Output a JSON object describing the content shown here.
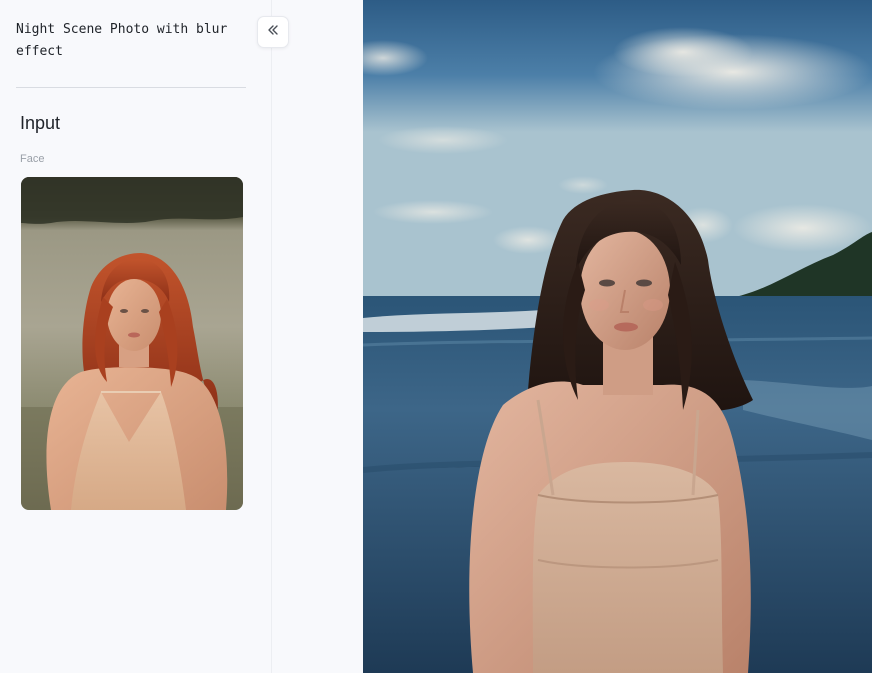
{
  "sidebar": {
    "workflow_title": "Night Scene Photo with blur effect",
    "section_title": "Input",
    "face_label": "Face",
    "face_image_alt": "woman-with-red-hair-in-light-dress-on-beach"
  },
  "output": {
    "image_alt": "woman-with-dark-hair-on-beach-at-dusk"
  },
  "colors": {
    "background": "#f8f9fc",
    "divider": "#d9dce2",
    "text": "#1f2329",
    "muted_text": "#9aa0a8"
  },
  "icons": {
    "collapse": "double-chevron-left-icon"
  }
}
